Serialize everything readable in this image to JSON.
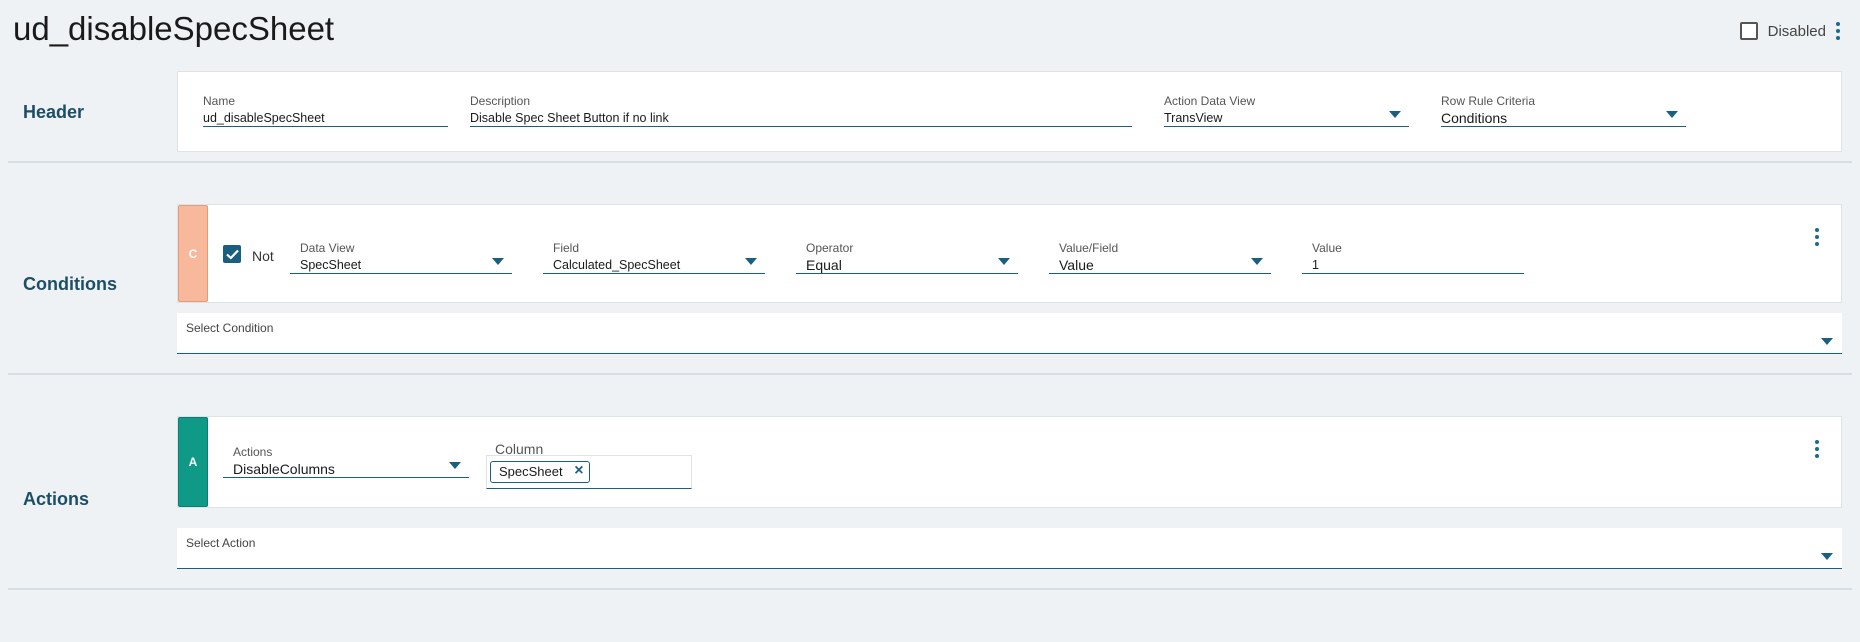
{
  "page": {
    "title": "ud_disableSpecSheet"
  },
  "topbar": {
    "disabled_label": "Disabled"
  },
  "header": {
    "section_label": "Header",
    "name": {
      "label": "Name",
      "value": "ud_disableSpecSheet"
    },
    "description": {
      "label": "Description",
      "value": "Disable Spec Sheet Button if no link"
    },
    "action_data_view": {
      "label": "Action Data View",
      "value": "TransView"
    },
    "row_rule_criteria": {
      "label": "Row Rule Criteria",
      "value": "Conditions"
    }
  },
  "conditions": {
    "section_label": "Conditions",
    "badge": "C",
    "not_label": "Not",
    "data_view": {
      "label": "Data View",
      "value": "SpecSheet"
    },
    "field": {
      "label": "Field",
      "value": "Calculated_SpecSheet"
    },
    "operator": {
      "label": "Operator",
      "value": "Equal"
    },
    "value_field": {
      "label": "Value/Field",
      "value": "Value"
    },
    "value": {
      "label": "Value",
      "value": "1"
    },
    "select_condition": {
      "label": "Select Condition"
    }
  },
  "actions": {
    "section_label": "Actions",
    "badge": "A",
    "actions_field": {
      "label": "Actions",
      "value": "DisableColumns"
    },
    "column": {
      "label": "Column",
      "chips": [
        "SpecSheet"
      ]
    },
    "select_action": {
      "label": "Select Action"
    }
  },
  "colors": {
    "accent": "#1b5f80",
    "condition_badge": "#f8b89b",
    "action_badge": "#0e9a86"
  }
}
